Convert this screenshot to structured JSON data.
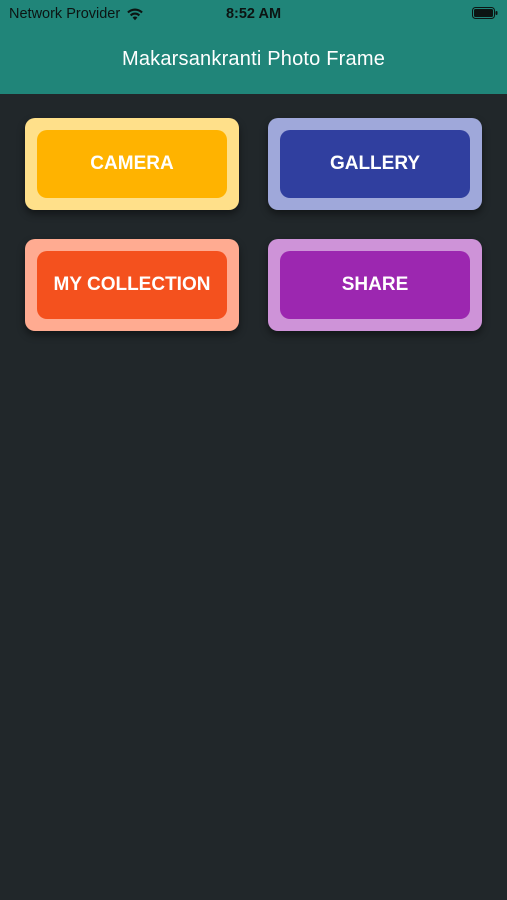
{
  "status_bar": {
    "carrier": "Network Provider",
    "time": "8:52 AM",
    "wifi_icon": "wifi-icon",
    "battery_icon": "battery-icon"
  },
  "app_bar": {
    "title": "Makarsankranti Photo Frame",
    "color": "#208579"
  },
  "background_color": "#21272a",
  "menu": {
    "camera": {
      "label": "CAMERA",
      "outer_color": "#ffe08a",
      "inner_color": "#ffb300"
    },
    "gallery": {
      "label": "GALLERY",
      "outer_color": "#9fa8da",
      "inner_color": "#303f9f"
    },
    "my_collection": {
      "label": "MY COLLECTION",
      "outer_color": "#ffab91",
      "inner_color": "#f4511e"
    },
    "share": {
      "label": "SHARE",
      "outer_color": "#ce93d8",
      "inner_color": "#9c27b0"
    }
  }
}
